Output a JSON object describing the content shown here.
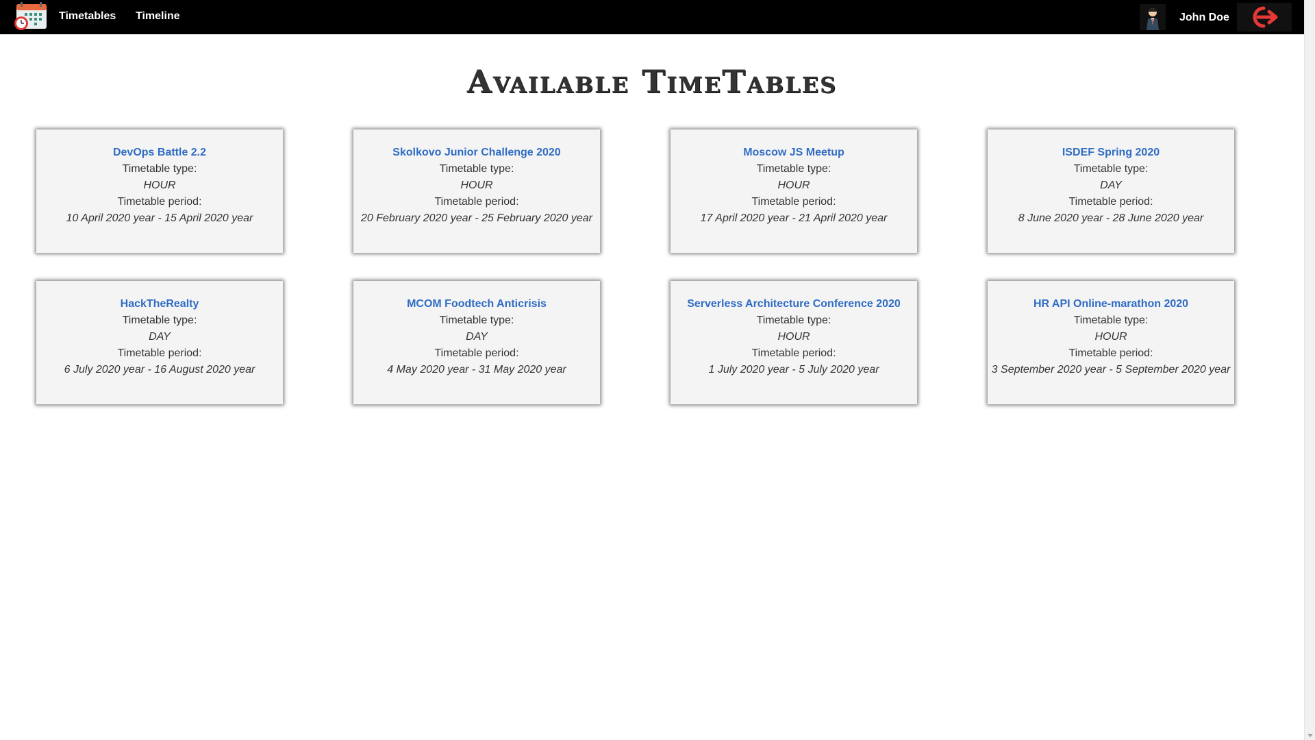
{
  "header": {
    "logo_icon": "calendar-clock-icon",
    "nav": [
      {
        "label": "Timetables"
      },
      {
        "label": "Timeline"
      }
    ],
    "user": {
      "name": "John Doe",
      "avatar_icon": "user-avatar-icon"
    },
    "logout_icon": "logout-icon",
    "accent_color": "#e53935"
  },
  "page": {
    "title": "Available TimeTables"
  },
  "labels": {
    "type_label": "Timetable type:",
    "period_label": "Timetable period:"
  },
  "timetables": [
    {
      "title": "DevOps Battle 2.2",
      "type": "HOUR",
      "period": "10 April 2020 year - 15 April 2020 year"
    },
    {
      "title": "Skolkovo Junior Challenge 2020",
      "type": "HOUR",
      "period": "20 February 2020 year - 25 February 2020 year"
    },
    {
      "title": "Moscow JS Meetup",
      "type": "HOUR",
      "period": "17 April 2020 year - 21 April 2020 year"
    },
    {
      "title": "ISDEF Spring 2020",
      "type": "DAY",
      "period": "8 June 2020 year - 28 June 2020 year"
    },
    {
      "title": "HackTheRealty",
      "type": "DAY",
      "period": "6 July 2020 year - 16 August 2020 year"
    },
    {
      "title": "MCOM Foodtech Anticrisis",
      "type": "DAY",
      "period": "4 May 2020 year - 31 May 2020 year"
    },
    {
      "title": "Serverless Architecture Conference 2020",
      "type": "HOUR",
      "period": "1 July 2020 year - 5 July 2020 year"
    },
    {
      "title": "HR API Online-marathon 2020",
      "type": "HOUR",
      "period": "3 September 2020 year - 5 September 2020 year"
    }
  ]
}
